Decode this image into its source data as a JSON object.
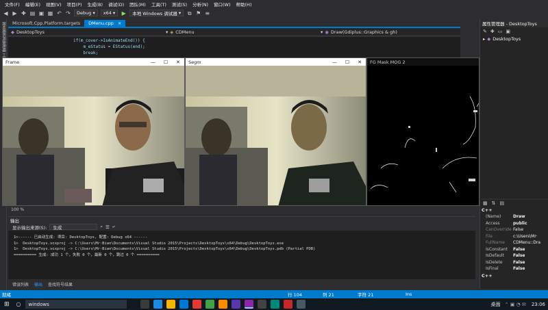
{
  "menu": [
    "文件(F)",
    "编辑(E)",
    "视图(V)",
    "项目(P)",
    "生成(B)",
    "调试(D)",
    "团队(M)",
    "工具(T)",
    "测试(S)",
    "分析(N)",
    "窗口(W)",
    "帮助(H)"
  ],
  "toolbar": {
    "config": "Debug",
    "platform": "x64",
    "run_target": "本地 Windows 调试器"
  },
  "left_strip": "服务器资源管理器 工具箱",
  "doc_tabs": [
    {
      "label": "Microsoft.Cpp.Platform.targets",
      "active": false
    },
    {
      "label": "DMenu.cpp",
      "active": true
    }
  ],
  "navbar": {
    "project": "DesktopToys",
    "class": "CDMenu",
    "method": "Draw(Gdiplus::Graphics & gh)"
  },
  "code_lines": [
    "if(m_cover->IsAnimateEnd()) {",
    "    m_eStatus = EStatus(end);",
    "    break;"
  ],
  "solution_explorer": {
    "title": "属性管理器 - DesktopToys",
    "root": "DesktopToys"
  },
  "cv_windows": [
    {
      "title": "Frame"
    },
    {
      "title": "Segm"
    },
    {
      "title": "FG Mask MOG 2"
    }
  ],
  "zoom": "100 %",
  "output": {
    "title": "输出",
    "source_label": "显示输出来源(S):",
    "source_value": "生成",
    "lines": [
      "1>------ 已启动生成: 项目: DesktopToys, 配置: Debug x64 ------",
      "1>  DesktopToys.vcxproj -> C:\\Users\\Mr·Bian\\Documents\\Visual Studio 2015\\Projects\\DesktopToys\\x64\\Debug\\DesktopToys.exe",
      "1>  DesktopToys.vcxproj -> C:\\Users\\Mr·Bian\\Documents\\Visual Studio 2015\\Projects\\DesktopToys\\x64\\Debug\\DesktopToys.pdb (Partial PDB)",
      "========== 生成: 成功 1 个，失败 0 个，最新 0 个，跳过 0 个 =========="
    ]
  },
  "bottom_tabs": [
    "错误列表",
    "输出",
    "查找符号结果"
  ],
  "properties": {
    "section": "C++",
    "rows": [
      {
        "k": "(Name)",
        "v": "Draw",
        "dim": false,
        "bold": true
      },
      {
        "k": "Access",
        "v": "public",
        "dim": false,
        "bold": true
      },
      {
        "k": "CanOverride",
        "v": "False",
        "dim": true,
        "bold": false
      },
      {
        "k": "File",
        "v": "c:\\Users\\Mr·",
        "dim": true,
        "bold": false
      },
      {
        "k": "FullName",
        "v": "CDMenu::Dra",
        "dim": true,
        "bold": false
      },
      {
        "k": "IsConstant",
        "v": "False",
        "dim": false,
        "bold": true
      },
      {
        "k": "IsDefault",
        "v": "False",
        "dim": false,
        "bold": true
      },
      {
        "k": "IsDelete",
        "v": "False",
        "dim": false,
        "bold": true
      },
      {
        "k": "IsFinal",
        "v": "False",
        "dim": false,
        "bold": true
      }
    ],
    "footer": "C++"
  },
  "status": {
    "left": "就绪",
    "row": "行 104",
    "col": "列 21",
    "char": "字符 21",
    "mode": "Ins"
  },
  "taskbar": {
    "search": "windows",
    "desktop": "桌面",
    "time": "23:06"
  },
  "colors": {
    "accent": "#007acc",
    "bg": "#2d2d30",
    "editor": "#1e1e1e"
  }
}
